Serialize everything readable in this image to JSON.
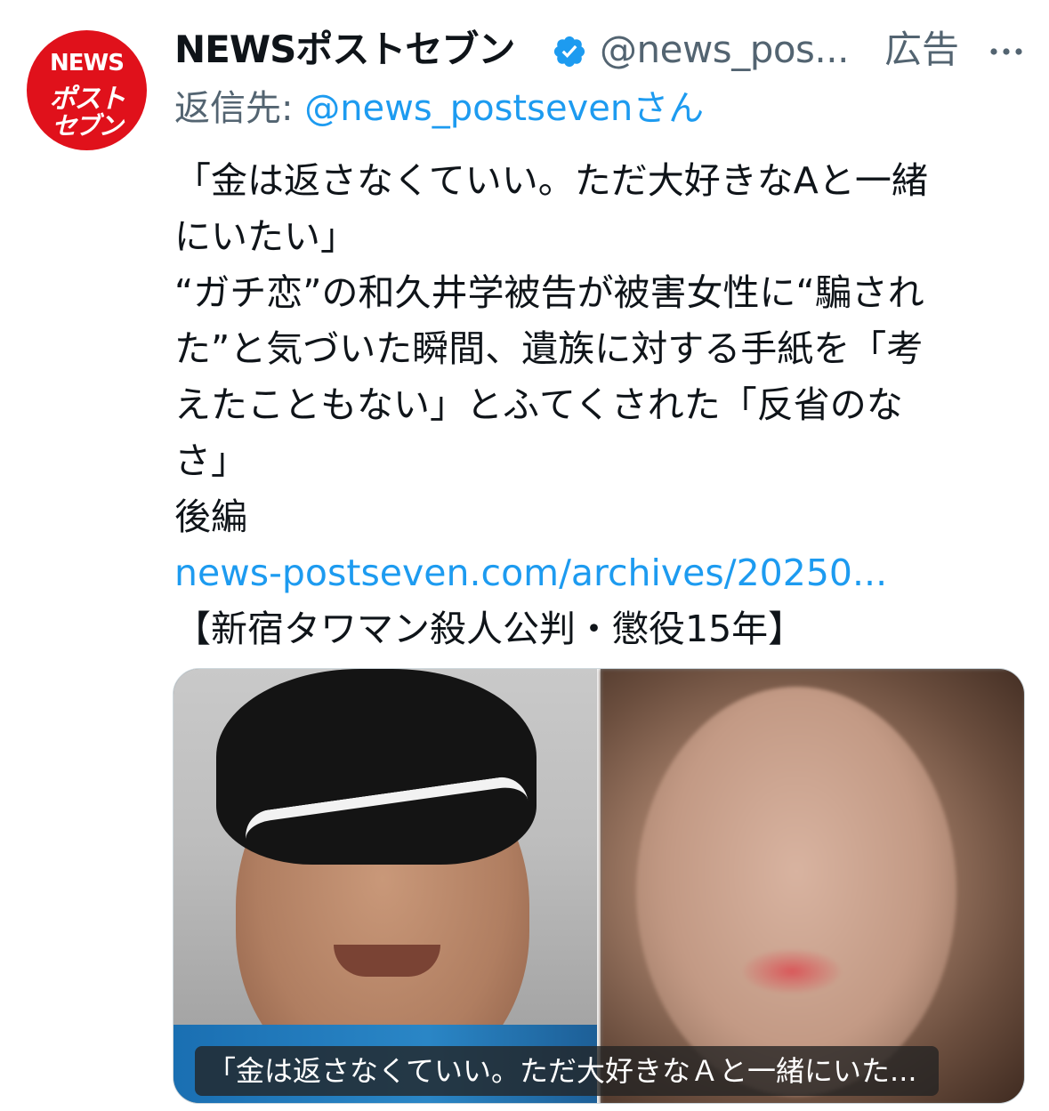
{
  "author": {
    "avatar_logo_lines": [
      "NEWS",
      "ポスト",
      "セブン"
    ],
    "name": "NEWSポストセブン",
    "handle": "@news_pos...",
    "ad_label": "広告",
    "verified_icon": "verified-badge-icon",
    "more_icon": "more-horizontal-icon"
  },
  "reply": {
    "prefix": "返信先: ",
    "handle": "@news_postseven",
    "suffix": "さん"
  },
  "tweet": {
    "lines": [
      "「金は返さなくていい。ただ大好きなAと一緒",
      "にいたい」",
      "“ガチ恋”の和久井学被告が被害女性に“騙され",
      "た”と気づいた瞬間、遺族に対する手紙を「考",
      "えたこともない」とふてくされた「反省のな",
      "さ」",
      "後編"
    ],
    "link": "news-postseven.com/archives/20250...",
    "tag_line": "【新宿タワマン殺人公判・懲役15年】"
  },
  "media": {
    "caption": "「金は返さなくていい。ただ大好きなＡと一緒にいた..."
  },
  "colors": {
    "accent": "#1d9bf0",
    "secondary_text": "#536471",
    "primary_text": "#0f1419",
    "avatar_red": "#e0111b"
  }
}
